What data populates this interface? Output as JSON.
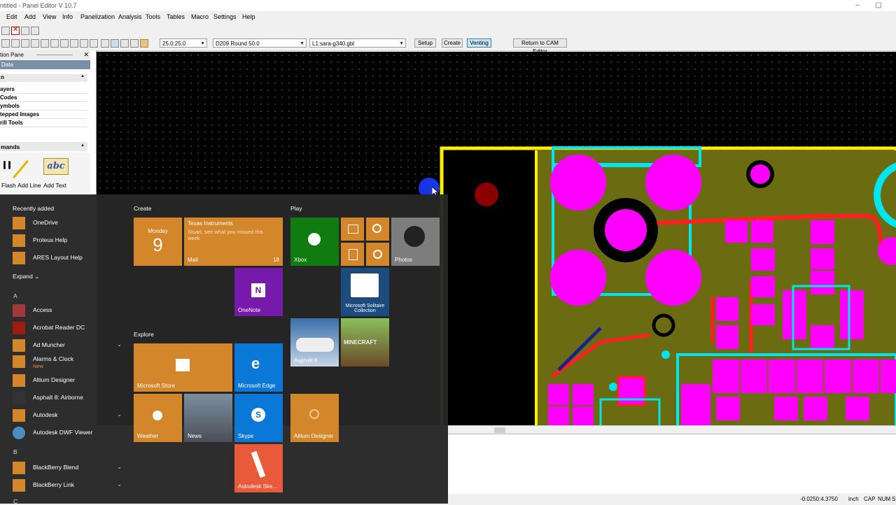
{
  "window": {
    "title": "ntitled - Panel Editor  V 10.7",
    "minimize": "–",
    "restore": "▢"
  },
  "menu": [
    "Edit",
    "Add",
    "View",
    "Info",
    "Panelization",
    "Analysis",
    "Tools",
    "Tables",
    "Macro",
    "Settings",
    "Help"
  ],
  "toolbar": {
    "grid_combo": "25.0:25.0",
    "aperture_combo": "D209  Round 50.0",
    "layer_combo": "L1:sara-g340.gbl",
    "setup": "Setup",
    "create": "Create",
    "venting": "Venting",
    "return_cam": "Return to CAM Editor"
  },
  "pane": {
    "title": "tion Pane",
    "close": "✕",
    "data_header": "Data",
    "section_arrow": "▲",
    "items": [
      "ayers",
      "Codes",
      "ymbols",
      "tepped Images",
      "rill  Tools"
    ],
    "commands_header": "mands",
    "commands": [
      "Flash",
      "Add Line",
      "Add Text"
    ],
    "abc": "abc"
  },
  "status": {
    "coords": "-0.0250:4.3750",
    "unit": "inch",
    "caps": "CAP",
    "num": "NUM",
    "scrl": "S"
  },
  "start": {
    "recently_added": "Recently added",
    "recent": [
      "OneDrive",
      "Proteus Help",
      "ARES Layout Help"
    ],
    "expand": "Expand",
    "letter_a": "A",
    "letter_b": "B",
    "letter_c": "C",
    "apps_a": [
      {
        "name": "Access",
        "sub": ""
      },
      {
        "name": "Acrobat Reader DC",
        "sub": ""
      },
      {
        "name": "Ad Muncher",
        "sub": ""
      },
      {
        "name": "Alarms & Clock",
        "sub": "New"
      },
      {
        "name": "Altium Designer",
        "sub": ""
      },
      {
        "name": "Asphalt 8: Airborne",
        "sub": ""
      },
      {
        "name": "Autodesk",
        "sub": ""
      },
      {
        "name": "Autodesk DWF Viewer",
        "sub": ""
      }
    ],
    "apps_b": [
      "BlackBerry Blend",
      "BlackBerry Link"
    ],
    "groups": {
      "create": "Create",
      "play": "Play",
      "explore": "Explore"
    },
    "tiles": {
      "calendar_day": "Monday",
      "calendar_date": "9",
      "mail_sender": "Texas Instruments",
      "mail_preview": "Stuart, see what you missed this week",
      "mail_label": "Mail",
      "mail_count": "18",
      "onenote": "OneNote",
      "xbox": "Xbox",
      "photos": "Photos",
      "solitaire": "Microsoft Solitaire Collection",
      "asphalt": "Asphalt 8",
      "minecraft": "MINECRAFT",
      "store": "Microsoft Store",
      "edge": "Microsoft Edge",
      "weather": "Weather",
      "news": "News",
      "skype": "Skype",
      "altium": "Altium Designer",
      "autodesk_sketch": "Autodesk Ske..."
    }
  }
}
